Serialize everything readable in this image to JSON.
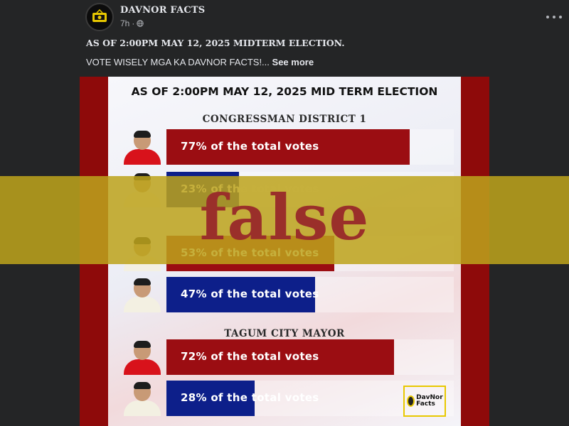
{
  "post": {
    "page_name": "DAVNOR FACTS",
    "time": "7h",
    "caption_line1": "AS OF 2:00PM MAY 12, 2025 MIDTERM ELECTION.",
    "caption_line2": "VOTE WISELY MGA KA DAVNOR FACTS!...",
    "see_more": "See more"
  },
  "icons": {
    "more": "more-options-icon",
    "audience": "globe-icon",
    "avatar": "davnor-facts-logo"
  },
  "graphic": {
    "title": "AS OF 2:00PM MAY 12, 2025 MID TERM ELECTION",
    "sections": [
      {
        "title": "CONGRESSMAN DISTRICT 1"
      },
      {
        "title": "TAGUM CITY MAYOR"
      }
    ],
    "rows": [
      {
        "label": "77% of the total votes",
        "value": 77,
        "color": "#9b0d12",
        "shirt": "#d8121b"
      },
      {
        "label": "23% of the total votes",
        "value": 23,
        "color": "#0d1f8a",
        "shirt": "#f3f0e2"
      },
      {
        "label": "53% of the total votes",
        "value": 53,
        "color": "#9b0d12",
        "shirt": "#f3f0e2"
      },
      {
        "label": "47% of the total votes",
        "value": 47,
        "color": "#0d1f8a",
        "shirt": "#f3f0e2"
      },
      {
        "label": "72% of the total votes",
        "value": 72,
        "color": "#9b0d12",
        "shirt": "#d8121b"
      },
      {
        "label": "28% of the total votes",
        "value": 28,
        "color": "#0d1f8a",
        "shirt": "#f3f0e2"
      }
    ],
    "watermark": "DavNor Facts"
  },
  "rating": {
    "label": "false",
    "band_color": "#bda31c",
    "text_color": "#9a2f2a"
  }
}
